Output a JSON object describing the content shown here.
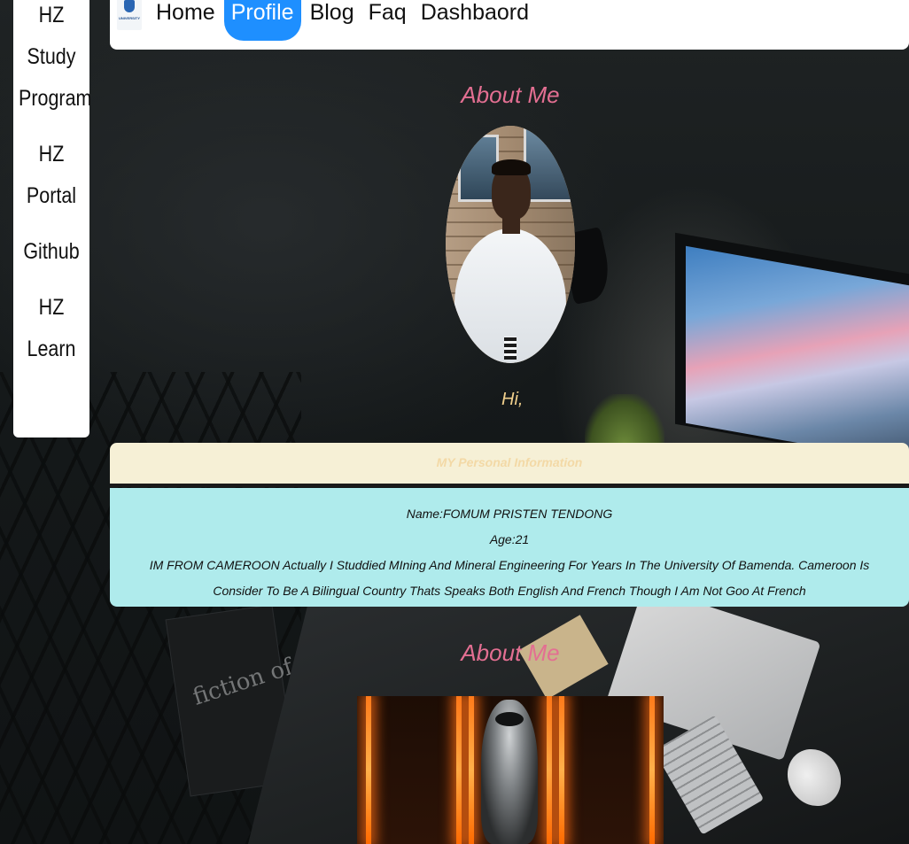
{
  "sidebar": {
    "items": [
      {
        "label_line1": "HZ Study",
        "label_line2": "Program"
      },
      {
        "label": "HZ Portal"
      },
      {
        "label": "Github"
      },
      {
        "label": "HZ Learn"
      }
    ]
  },
  "nav": {
    "logo_text": "UNIVERSITY",
    "items": [
      {
        "label": "Home",
        "active": false
      },
      {
        "label": "Profile",
        "active": true
      },
      {
        "label": "Blog",
        "active": false
      },
      {
        "label": "Faq",
        "active": false
      },
      {
        "label": "Dashbaord",
        "active": false
      }
    ],
    "active_color": "#1e8fff"
  },
  "about": {
    "title": "About Me",
    "greeting": "Hi,",
    "title_color": "#e36f92"
  },
  "personal_info": {
    "header": "MY Personal Information",
    "name": "Name:FOMUM PRISTEN TENDONG",
    "age": "Age:21",
    "bio": "IM FROM CAMEROON Actually I Studdied MIning And Mineral Engineering For Years In The University Of Bamenda. Cameroon Is Consider To Be A Bilingual Country Thats Speaks Both English And French Though I Am Not Goo At French",
    "header_bg": "#f6f0d6",
    "body_bg": "#afebec"
  },
  "about_second": {
    "title": "About Me"
  },
  "background": {
    "poster_text": "fiction of the difficult to do"
  }
}
